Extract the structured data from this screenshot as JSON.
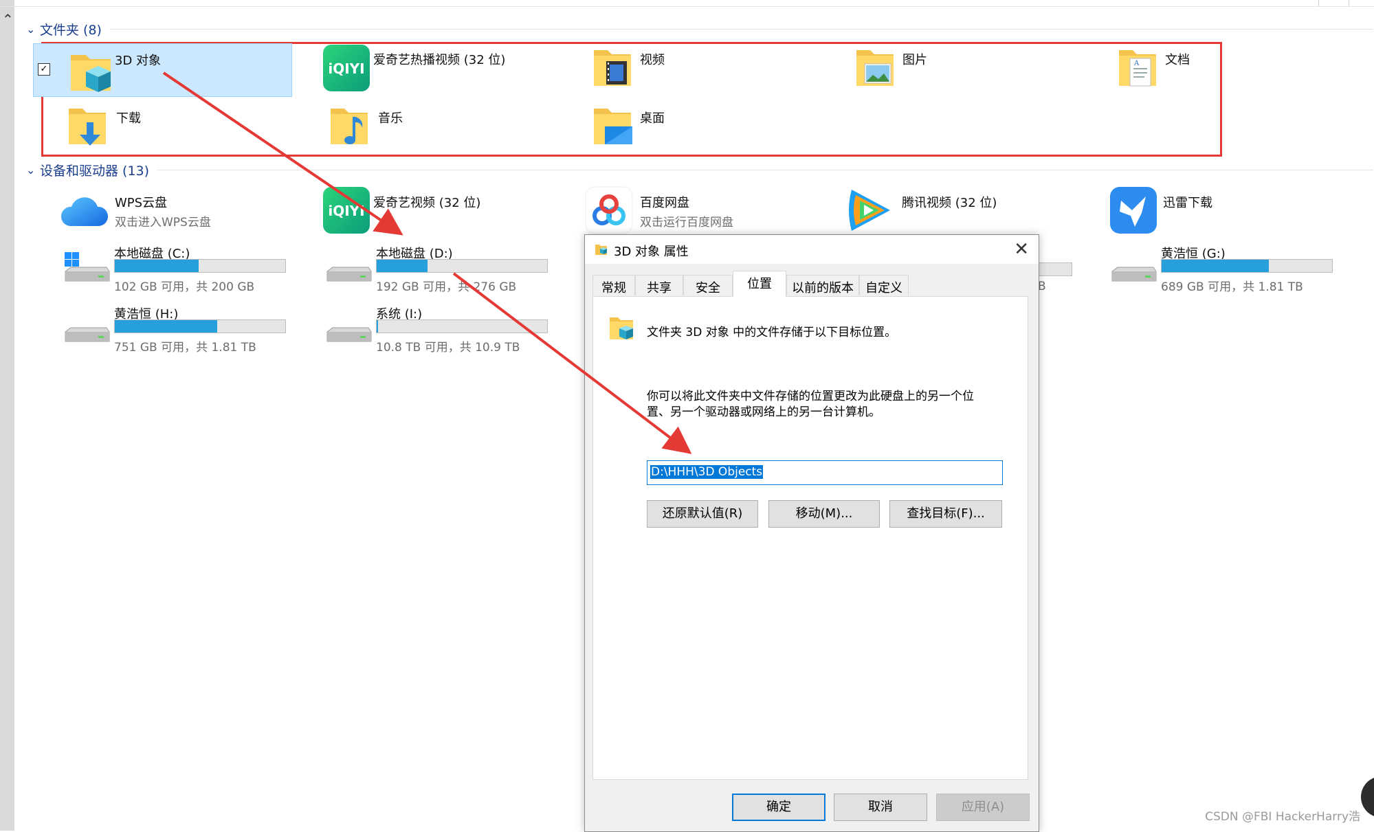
{
  "folders_section": {
    "title": "文件夹 (8)"
  },
  "devices_section": {
    "title": "设备和驱动器 (13)"
  },
  "folders": [
    {
      "label": "3D 对象",
      "icon": "3d-objects-folder-icon"
    },
    {
      "label": "爱奇艺热播视频 (32 位)",
      "icon": "iqiyi-app-icon"
    },
    {
      "label": "视频",
      "icon": "videos-folder-icon"
    },
    {
      "label": "图片",
      "icon": "pictures-folder-icon"
    },
    {
      "label": "文档",
      "icon": "documents-folder-icon"
    },
    {
      "label": "下载",
      "icon": "downloads-folder-icon"
    },
    {
      "label": "音乐",
      "icon": "music-folder-icon"
    },
    {
      "label": "桌面",
      "icon": "desktop-folder-icon"
    }
  ],
  "apps": [
    {
      "label": "WPS云盘",
      "sub": "双击进入WPS云盘",
      "icon": "wps-cloud-icon"
    },
    {
      "label": "爱奇艺视频 (32 位)",
      "sub": "",
      "icon": "iqiyi-app-icon"
    },
    {
      "label": "百度网盘",
      "sub": "双击运行百度网盘",
      "icon": "baidu-netdisk-icon"
    },
    {
      "label": "腾讯视频 (32 位)",
      "sub": "",
      "icon": "tencent-video-icon"
    },
    {
      "label": "迅雷下载",
      "sub": "",
      "icon": "xunlei-icon"
    }
  ],
  "drives": [
    {
      "label": "本地磁盘 (C:)",
      "sub": "102 GB 可用，共 200 GB",
      "used_fraction": 0.49,
      "icon": "windows-drive-icon"
    },
    {
      "label": "本地磁盘 (D:)",
      "sub": "192 GB 可用，共 276 GB",
      "used_fraction": 0.3,
      "icon": "hard-drive-icon"
    },
    {
      "label": "黄浩恒 (G:)",
      "sub": "689 GB 可用，共 1.81 TB",
      "used_fraction": 0.63,
      "icon": "hard-drive-icon"
    },
    {
      "label": "黄浩恒 (H:)",
      "sub": "751 GB 可用，共 1.81 TB",
      "used_fraction": 0.6,
      "icon": "hard-drive-icon"
    },
    {
      "label": "系统 (I:)",
      "sub": "10.8 TB 可用，共 10.9 TB",
      "used_fraction": 0.01,
      "icon": "hard-drive-icon"
    }
  ],
  "hidden_drive_partial": {
    "sub": "B"
  },
  "dialog": {
    "title": "3D 对象 属性",
    "tabs": [
      "常规",
      "共享",
      "安全",
      "位置",
      "以前的版本",
      "自定义"
    ],
    "active_tab": "位置",
    "info_text": "文件夹 3D 对象 中的文件存储于以下目标位置。",
    "desc_line1": "你可以将此文件夹中文件存储的位置更改为此硬盘上的另一个位",
    "desc_line2": "置、另一个驱动器或网络上的另一台计算机。",
    "path_value": "D:\\HHH\\3D Objects",
    "restore_btn": "还原默认值(R)",
    "move_btn": "移动(M)...",
    "find_btn": "查找目标(F)...",
    "ok_btn": "确定",
    "cancel_btn": "取消",
    "apply_btn": "应用(A)"
  },
  "watermark": "CSDN @FBI HackerHarry浩",
  "colors": {
    "accent": "#26a0da",
    "selection": "#cce8ff",
    "annotation_red": "#e53935",
    "section_blue": "#1a3e8e"
  }
}
